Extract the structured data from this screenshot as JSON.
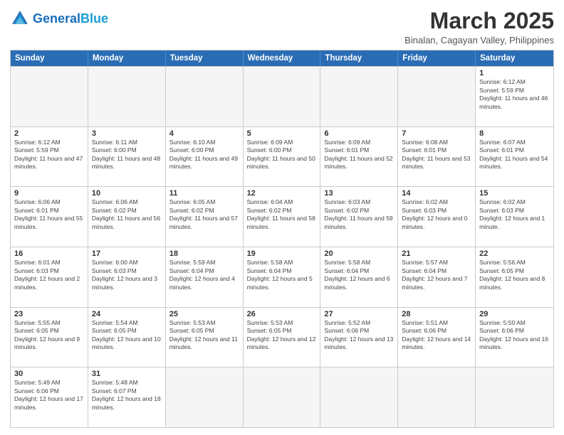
{
  "header": {
    "logo_general": "General",
    "logo_blue": "Blue",
    "title": "March 2025",
    "subtitle": "Binalan, Cagayan Valley, Philippines"
  },
  "calendar": {
    "days": [
      "Sunday",
      "Monday",
      "Tuesday",
      "Wednesday",
      "Thursday",
      "Friday",
      "Saturday"
    ],
    "rows": [
      [
        {
          "day": "",
          "empty": true
        },
        {
          "day": "",
          "empty": true
        },
        {
          "day": "",
          "empty": true
        },
        {
          "day": "",
          "empty": true
        },
        {
          "day": "",
          "empty": true
        },
        {
          "day": "",
          "empty": true
        },
        {
          "day": "1",
          "info": "Sunrise: 6:12 AM\nSunset: 5:59 PM\nDaylight: 11 hours and 46 minutes."
        }
      ],
      [
        {
          "day": "2",
          "info": "Sunrise: 6:12 AM\nSunset: 5:59 PM\nDaylight: 11 hours and 47 minutes."
        },
        {
          "day": "3",
          "info": "Sunrise: 6:11 AM\nSunset: 6:00 PM\nDaylight: 11 hours and 48 minutes."
        },
        {
          "day": "4",
          "info": "Sunrise: 6:10 AM\nSunset: 6:00 PM\nDaylight: 11 hours and 49 minutes."
        },
        {
          "day": "5",
          "info": "Sunrise: 6:09 AM\nSunset: 6:00 PM\nDaylight: 11 hours and 50 minutes."
        },
        {
          "day": "6",
          "info": "Sunrise: 6:09 AM\nSunset: 6:01 PM\nDaylight: 11 hours and 52 minutes."
        },
        {
          "day": "7",
          "info": "Sunrise: 6:08 AM\nSunset: 6:01 PM\nDaylight: 11 hours and 53 minutes."
        },
        {
          "day": "8",
          "info": "Sunrise: 6:07 AM\nSunset: 6:01 PM\nDaylight: 11 hours and 54 minutes."
        }
      ],
      [
        {
          "day": "9",
          "info": "Sunrise: 6:06 AM\nSunset: 6:01 PM\nDaylight: 11 hours and 55 minutes."
        },
        {
          "day": "10",
          "info": "Sunrise: 6:06 AM\nSunset: 6:02 PM\nDaylight: 11 hours and 56 minutes."
        },
        {
          "day": "11",
          "info": "Sunrise: 6:05 AM\nSunset: 6:02 PM\nDaylight: 11 hours and 57 minutes."
        },
        {
          "day": "12",
          "info": "Sunrise: 6:04 AM\nSunset: 6:02 PM\nDaylight: 11 hours and 58 minutes."
        },
        {
          "day": "13",
          "info": "Sunrise: 6:03 AM\nSunset: 6:02 PM\nDaylight: 11 hours and 59 minutes."
        },
        {
          "day": "14",
          "info": "Sunrise: 6:02 AM\nSunset: 6:03 PM\nDaylight: 12 hours and 0 minutes."
        },
        {
          "day": "15",
          "info": "Sunrise: 6:02 AM\nSunset: 6:03 PM\nDaylight: 12 hours and 1 minute."
        }
      ],
      [
        {
          "day": "16",
          "info": "Sunrise: 6:01 AM\nSunset: 6:03 PM\nDaylight: 12 hours and 2 minutes."
        },
        {
          "day": "17",
          "info": "Sunrise: 6:00 AM\nSunset: 6:03 PM\nDaylight: 12 hours and 3 minutes."
        },
        {
          "day": "18",
          "info": "Sunrise: 5:59 AM\nSunset: 6:04 PM\nDaylight: 12 hours and 4 minutes."
        },
        {
          "day": "19",
          "info": "Sunrise: 5:58 AM\nSunset: 6:04 PM\nDaylight: 12 hours and 5 minutes."
        },
        {
          "day": "20",
          "info": "Sunrise: 5:58 AM\nSunset: 6:04 PM\nDaylight: 12 hours and 6 minutes."
        },
        {
          "day": "21",
          "info": "Sunrise: 5:57 AM\nSunset: 6:04 PM\nDaylight: 12 hours and 7 minutes."
        },
        {
          "day": "22",
          "info": "Sunrise: 5:56 AM\nSunset: 6:05 PM\nDaylight: 12 hours and 8 minutes."
        }
      ],
      [
        {
          "day": "23",
          "info": "Sunrise: 5:55 AM\nSunset: 6:05 PM\nDaylight: 12 hours and 9 minutes."
        },
        {
          "day": "24",
          "info": "Sunrise: 5:54 AM\nSunset: 6:05 PM\nDaylight: 12 hours and 10 minutes."
        },
        {
          "day": "25",
          "info": "Sunrise: 5:53 AM\nSunset: 6:05 PM\nDaylight: 12 hours and 11 minutes."
        },
        {
          "day": "26",
          "info": "Sunrise: 5:53 AM\nSunset: 6:05 PM\nDaylight: 12 hours and 12 minutes."
        },
        {
          "day": "27",
          "info": "Sunrise: 5:52 AM\nSunset: 6:06 PM\nDaylight: 12 hours and 13 minutes."
        },
        {
          "day": "28",
          "info": "Sunrise: 5:51 AM\nSunset: 6:06 PM\nDaylight: 12 hours and 14 minutes."
        },
        {
          "day": "29",
          "info": "Sunrise: 5:50 AM\nSunset: 6:06 PM\nDaylight: 12 hours and 16 minutes."
        }
      ],
      [
        {
          "day": "30",
          "info": "Sunrise: 5:49 AM\nSunset: 6:06 PM\nDaylight: 12 hours and 17 minutes."
        },
        {
          "day": "31",
          "info": "Sunrise: 5:48 AM\nSunset: 6:07 PM\nDaylight: 12 hours and 18 minutes."
        },
        {
          "day": "",
          "empty": true
        },
        {
          "day": "",
          "empty": true
        },
        {
          "day": "",
          "empty": true
        },
        {
          "day": "",
          "empty": true
        },
        {
          "day": "",
          "empty": true
        }
      ]
    ]
  }
}
